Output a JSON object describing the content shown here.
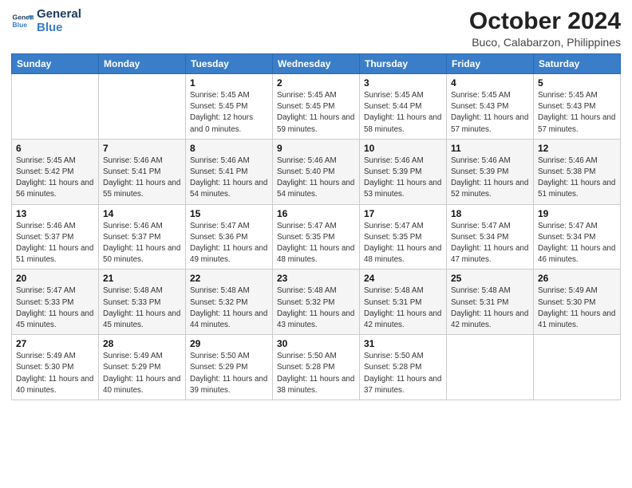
{
  "header": {
    "logo_line1": "General",
    "logo_line2": "Blue",
    "month": "October 2024",
    "location": "Buco, Calabarzon, Philippines"
  },
  "weekdays": [
    "Sunday",
    "Monday",
    "Tuesday",
    "Wednesday",
    "Thursday",
    "Friday",
    "Saturday"
  ],
  "weeks": [
    [
      {
        "day": "",
        "info": ""
      },
      {
        "day": "",
        "info": ""
      },
      {
        "day": "1",
        "info": "Sunrise: 5:45 AM\nSunset: 5:45 PM\nDaylight: 12 hours\nand 0 minutes."
      },
      {
        "day": "2",
        "info": "Sunrise: 5:45 AM\nSunset: 5:45 PM\nDaylight: 11 hours\nand 59 minutes."
      },
      {
        "day": "3",
        "info": "Sunrise: 5:45 AM\nSunset: 5:44 PM\nDaylight: 11 hours\nand 58 minutes."
      },
      {
        "day": "4",
        "info": "Sunrise: 5:45 AM\nSunset: 5:43 PM\nDaylight: 11 hours\nand 57 minutes."
      },
      {
        "day": "5",
        "info": "Sunrise: 5:45 AM\nSunset: 5:43 PM\nDaylight: 11 hours\nand 57 minutes."
      }
    ],
    [
      {
        "day": "6",
        "info": "Sunrise: 5:45 AM\nSunset: 5:42 PM\nDaylight: 11 hours\nand 56 minutes."
      },
      {
        "day": "7",
        "info": "Sunrise: 5:46 AM\nSunset: 5:41 PM\nDaylight: 11 hours\nand 55 minutes."
      },
      {
        "day": "8",
        "info": "Sunrise: 5:46 AM\nSunset: 5:41 PM\nDaylight: 11 hours\nand 54 minutes."
      },
      {
        "day": "9",
        "info": "Sunrise: 5:46 AM\nSunset: 5:40 PM\nDaylight: 11 hours\nand 54 minutes."
      },
      {
        "day": "10",
        "info": "Sunrise: 5:46 AM\nSunset: 5:39 PM\nDaylight: 11 hours\nand 53 minutes."
      },
      {
        "day": "11",
        "info": "Sunrise: 5:46 AM\nSunset: 5:39 PM\nDaylight: 11 hours\nand 52 minutes."
      },
      {
        "day": "12",
        "info": "Sunrise: 5:46 AM\nSunset: 5:38 PM\nDaylight: 11 hours\nand 51 minutes."
      }
    ],
    [
      {
        "day": "13",
        "info": "Sunrise: 5:46 AM\nSunset: 5:37 PM\nDaylight: 11 hours\nand 51 minutes."
      },
      {
        "day": "14",
        "info": "Sunrise: 5:46 AM\nSunset: 5:37 PM\nDaylight: 11 hours\nand 50 minutes."
      },
      {
        "day": "15",
        "info": "Sunrise: 5:47 AM\nSunset: 5:36 PM\nDaylight: 11 hours\nand 49 minutes."
      },
      {
        "day": "16",
        "info": "Sunrise: 5:47 AM\nSunset: 5:35 PM\nDaylight: 11 hours\nand 48 minutes."
      },
      {
        "day": "17",
        "info": "Sunrise: 5:47 AM\nSunset: 5:35 PM\nDaylight: 11 hours\nand 48 minutes."
      },
      {
        "day": "18",
        "info": "Sunrise: 5:47 AM\nSunset: 5:34 PM\nDaylight: 11 hours\nand 47 minutes."
      },
      {
        "day": "19",
        "info": "Sunrise: 5:47 AM\nSunset: 5:34 PM\nDaylight: 11 hours\nand 46 minutes."
      }
    ],
    [
      {
        "day": "20",
        "info": "Sunrise: 5:47 AM\nSunset: 5:33 PM\nDaylight: 11 hours\nand 45 minutes."
      },
      {
        "day": "21",
        "info": "Sunrise: 5:48 AM\nSunset: 5:33 PM\nDaylight: 11 hours\nand 45 minutes."
      },
      {
        "day": "22",
        "info": "Sunrise: 5:48 AM\nSunset: 5:32 PM\nDaylight: 11 hours\nand 44 minutes."
      },
      {
        "day": "23",
        "info": "Sunrise: 5:48 AM\nSunset: 5:32 PM\nDaylight: 11 hours\nand 43 minutes."
      },
      {
        "day": "24",
        "info": "Sunrise: 5:48 AM\nSunset: 5:31 PM\nDaylight: 11 hours\nand 42 minutes."
      },
      {
        "day": "25",
        "info": "Sunrise: 5:48 AM\nSunset: 5:31 PM\nDaylight: 11 hours\nand 42 minutes."
      },
      {
        "day": "26",
        "info": "Sunrise: 5:49 AM\nSunset: 5:30 PM\nDaylight: 11 hours\nand 41 minutes."
      }
    ],
    [
      {
        "day": "27",
        "info": "Sunrise: 5:49 AM\nSunset: 5:30 PM\nDaylight: 11 hours\nand 40 minutes."
      },
      {
        "day": "28",
        "info": "Sunrise: 5:49 AM\nSunset: 5:29 PM\nDaylight: 11 hours\nand 40 minutes."
      },
      {
        "day": "29",
        "info": "Sunrise: 5:50 AM\nSunset: 5:29 PM\nDaylight: 11 hours\nand 39 minutes."
      },
      {
        "day": "30",
        "info": "Sunrise: 5:50 AM\nSunset: 5:28 PM\nDaylight: 11 hours\nand 38 minutes."
      },
      {
        "day": "31",
        "info": "Sunrise: 5:50 AM\nSunset: 5:28 PM\nDaylight: 11 hours\nand 37 minutes."
      },
      {
        "day": "",
        "info": ""
      },
      {
        "day": "",
        "info": ""
      }
    ]
  ]
}
